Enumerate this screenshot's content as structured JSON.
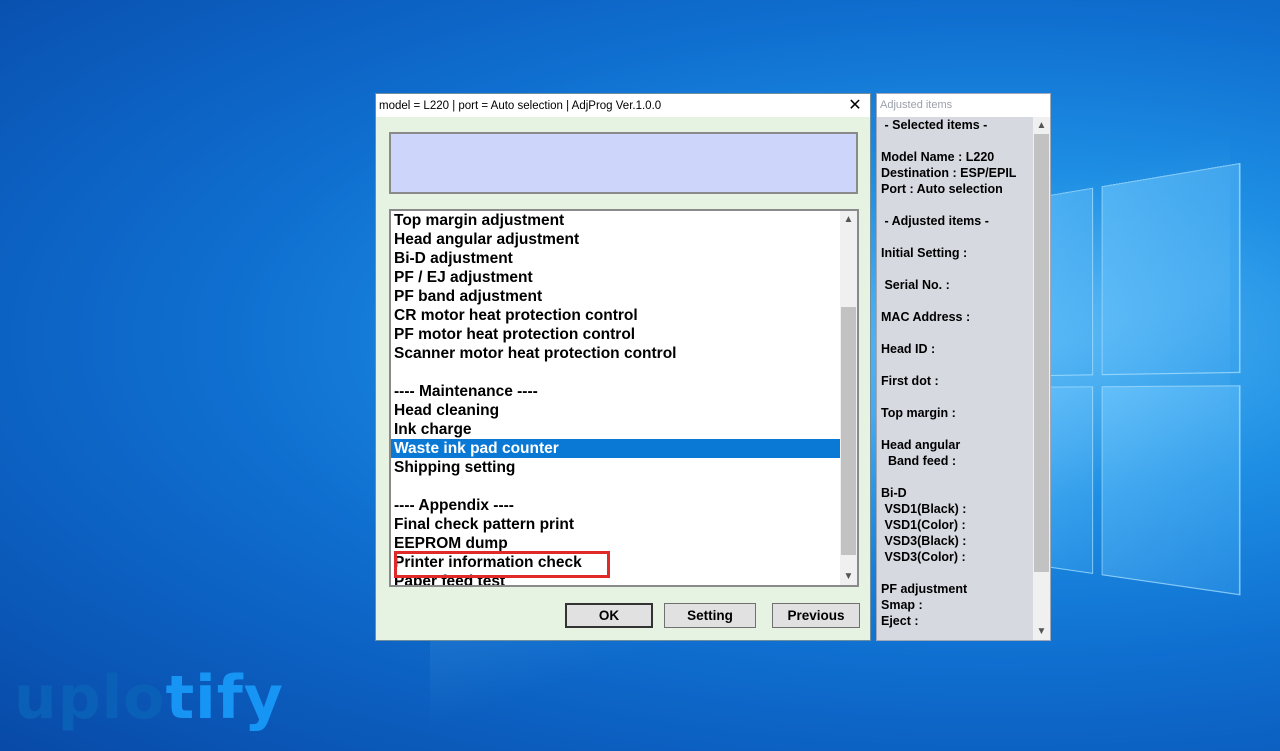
{
  "window": {
    "title": "model = L220 | port = Auto selection | AdjProg Ver.1.0.0",
    "close_glyph": "✕"
  },
  "message_box": {
    "text": ""
  },
  "list": {
    "items": [
      "Top margin adjustment",
      "Head angular adjustment",
      "Bi-D adjustment",
      "PF / EJ adjustment",
      "PF band adjustment",
      "CR motor heat protection control",
      "PF motor heat protection control",
      "Scanner motor heat protection control",
      "",
      "---- Maintenance ----",
      "Head cleaning",
      "Ink charge",
      "Waste ink pad counter",
      "Shipping setting",
      "",
      "---- Appendix ----",
      "Final check pattern print",
      "EEPROM dump",
      "Printer information check",
      "Paper feed test"
    ],
    "selected_index": 12
  },
  "buttons": {
    "ok": "OK",
    "setting": "Setting",
    "previous": "Previous"
  },
  "side_panel": {
    "title": "Adjusted items",
    "lines": [
      " - Selected items -",
      "",
      "Model Name : L220",
      "Destination : ESP/EPIL",
      "Port : Auto selection",
      "",
      " - Adjusted items -",
      "",
      "Initial Setting :",
      "",
      " Serial No. :",
      "",
      "MAC Address :",
      "",
      "Head ID :",
      "",
      "First dot :",
      "",
      "Top margin :",
      "",
      "Head angular",
      "  Band feed :",
      "",
      "Bi-D",
      " VSD1(Black) :",
      " VSD1(Color) :",
      " VSD3(Black) :",
      " VSD3(Color) :",
      "",
      "PF adjustment",
      "Smap :",
      "Eject :"
    ]
  },
  "scroll": {
    "up": "^",
    "down": "v"
  },
  "watermark": {
    "part1": "uplo",
    "part2": "tify"
  },
  "colors": {
    "selection": "#0a79d6",
    "highlight": "#e02a2a",
    "dialog_bg": "#e6f3e2",
    "message_bg": "#cdd5fa"
  }
}
